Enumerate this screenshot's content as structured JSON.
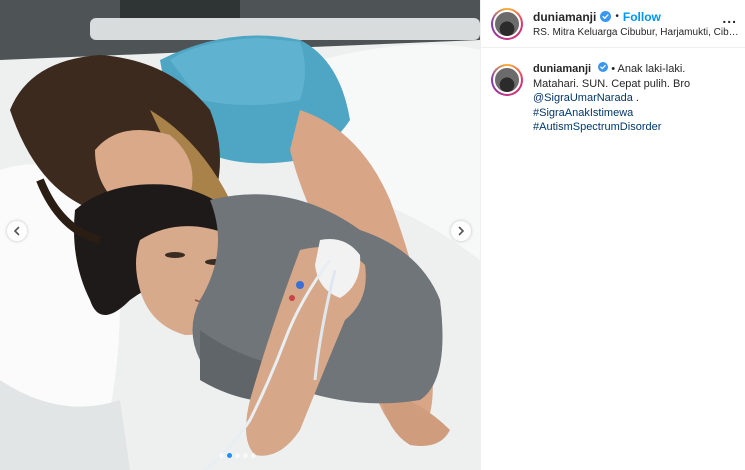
{
  "post": {
    "username": "duniamanji",
    "follow_label": "Follow",
    "separator": "•",
    "location": "RS. Mitra Keluarga Cibubur, Harjamukti, Cibubur",
    "more_label": "...",
    "caption": {
      "text_line1": "• Anak laki-laki.",
      "text_line2": "Matahari. SUN. Cepat pulih. Bro",
      "mention": "@SigraUmarNarada",
      "mention_suffix": " .",
      "hashtags": [
        "#SigraAnakIstimewa",
        "#AutismSpectrumDisorder"
      ]
    }
  },
  "carousel": {
    "total_slides": 5,
    "active_index": 1
  },
  "icons": {
    "left_arrow": "chevron-left-icon",
    "right_arrow": "chevron-right-icon",
    "verified": "verified-badge-icon",
    "more": "more-options-icon"
  },
  "colors": {
    "follow": "#0095f6",
    "link": "#00376b",
    "verified": "#3897f0",
    "active_dot": "#1f8fff"
  }
}
